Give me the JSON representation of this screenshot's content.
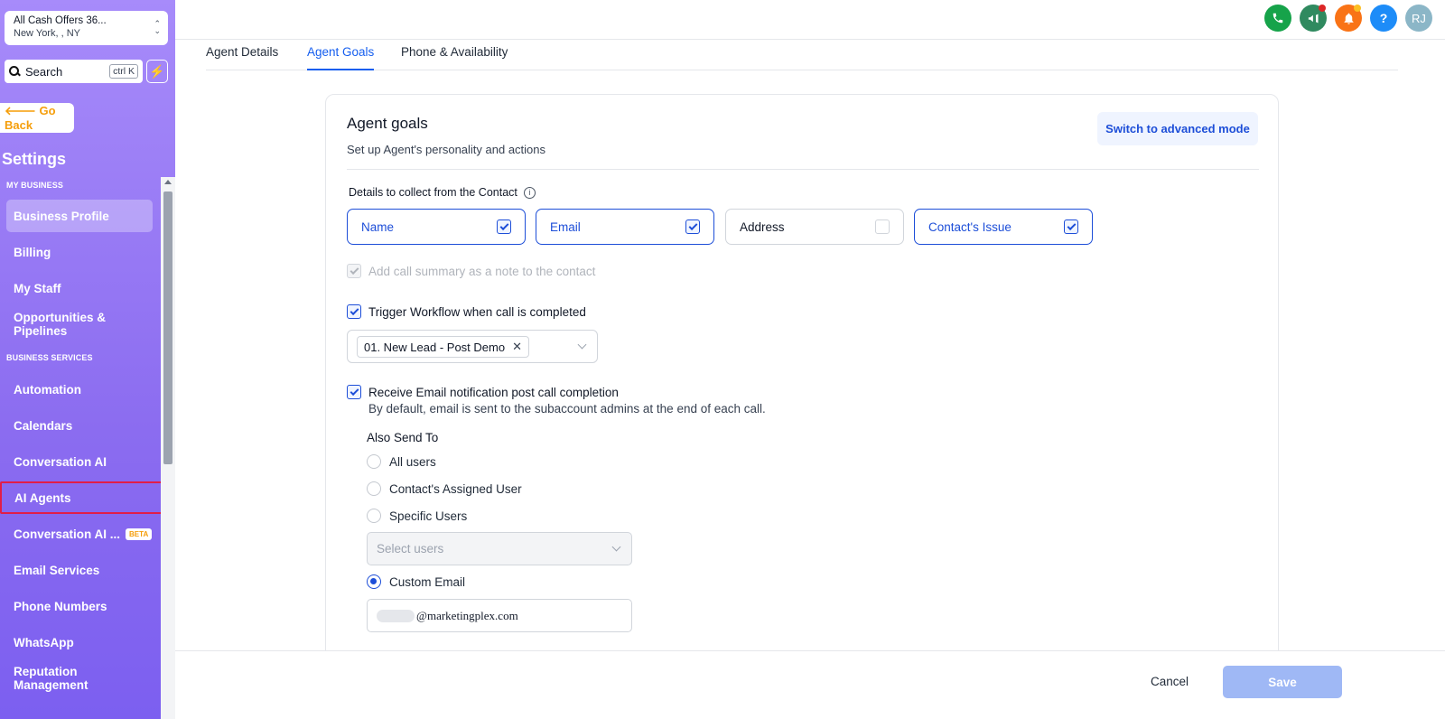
{
  "account": {
    "name": "All Cash Offers 36...",
    "location": "New York, , NY"
  },
  "search": {
    "label": "Search",
    "shortcut": "ctrl K"
  },
  "go_back": "🡐 Go Back",
  "sidebar": {
    "title": "Settings",
    "section_my_business": "MY BUSINESS",
    "section_business_services": "BUSINESS SERVICES",
    "items": [
      {
        "label": "Business Profile"
      },
      {
        "label": "Billing"
      },
      {
        "label": "My Staff"
      },
      {
        "label": "Opportunities & Pipelines"
      },
      {
        "label": "Automation"
      },
      {
        "label": "Calendars"
      },
      {
        "label": "Conversation AI"
      },
      {
        "label": "AI Agents"
      },
      {
        "label": "Conversation AI ...",
        "badge": "BETA"
      },
      {
        "label": "Email Services"
      },
      {
        "label": "Phone Numbers"
      },
      {
        "label": "WhatsApp"
      },
      {
        "label": "Reputation Management"
      }
    ]
  },
  "topbar": {
    "phone_color": "#16a34a",
    "megaphone_color": "#2f8a5f",
    "bell_color": "#f97316",
    "help_label": "?",
    "help_color": "#1d8cf8",
    "avatar_initials": "RJ",
    "avatar_color": "#8bb6c7"
  },
  "tabs": [
    {
      "label": "Agent Details"
    },
    {
      "label": "Agent Goals"
    },
    {
      "label": "Phone & Availability"
    }
  ],
  "card": {
    "title": "Agent goals",
    "subtitle": "Set up Agent's personality and actions",
    "advanced_button": "Switch to advanced mode",
    "details_label": "Details to collect from the Contact",
    "details_options": [
      {
        "label": "Name",
        "checked": true
      },
      {
        "label": "Email",
        "checked": true
      },
      {
        "label": "Address",
        "checked": false
      },
      {
        "label": "Contact's Issue",
        "checked": true
      }
    ],
    "call_summary_label": "Add call summary as a note to the contact",
    "trigger_workflow_label": "Trigger Workflow when call is completed",
    "workflow_chip": "01. New Lead - Post Demo",
    "email_notify_label": "Receive Email notification post call completion",
    "email_notify_note": "By default, email is sent to the subaccount admins at the end of each call.",
    "also_send_to": "Also Send To",
    "radio_options": [
      "All users",
      "Contact's Assigned User",
      "Specific Users"
    ],
    "select_users_placeholder": "Select users",
    "custom_email_label": "Custom Email",
    "custom_email_value": "@marketingplex.com"
  },
  "footer": {
    "cancel": "Cancel",
    "save": "Save"
  }
}
